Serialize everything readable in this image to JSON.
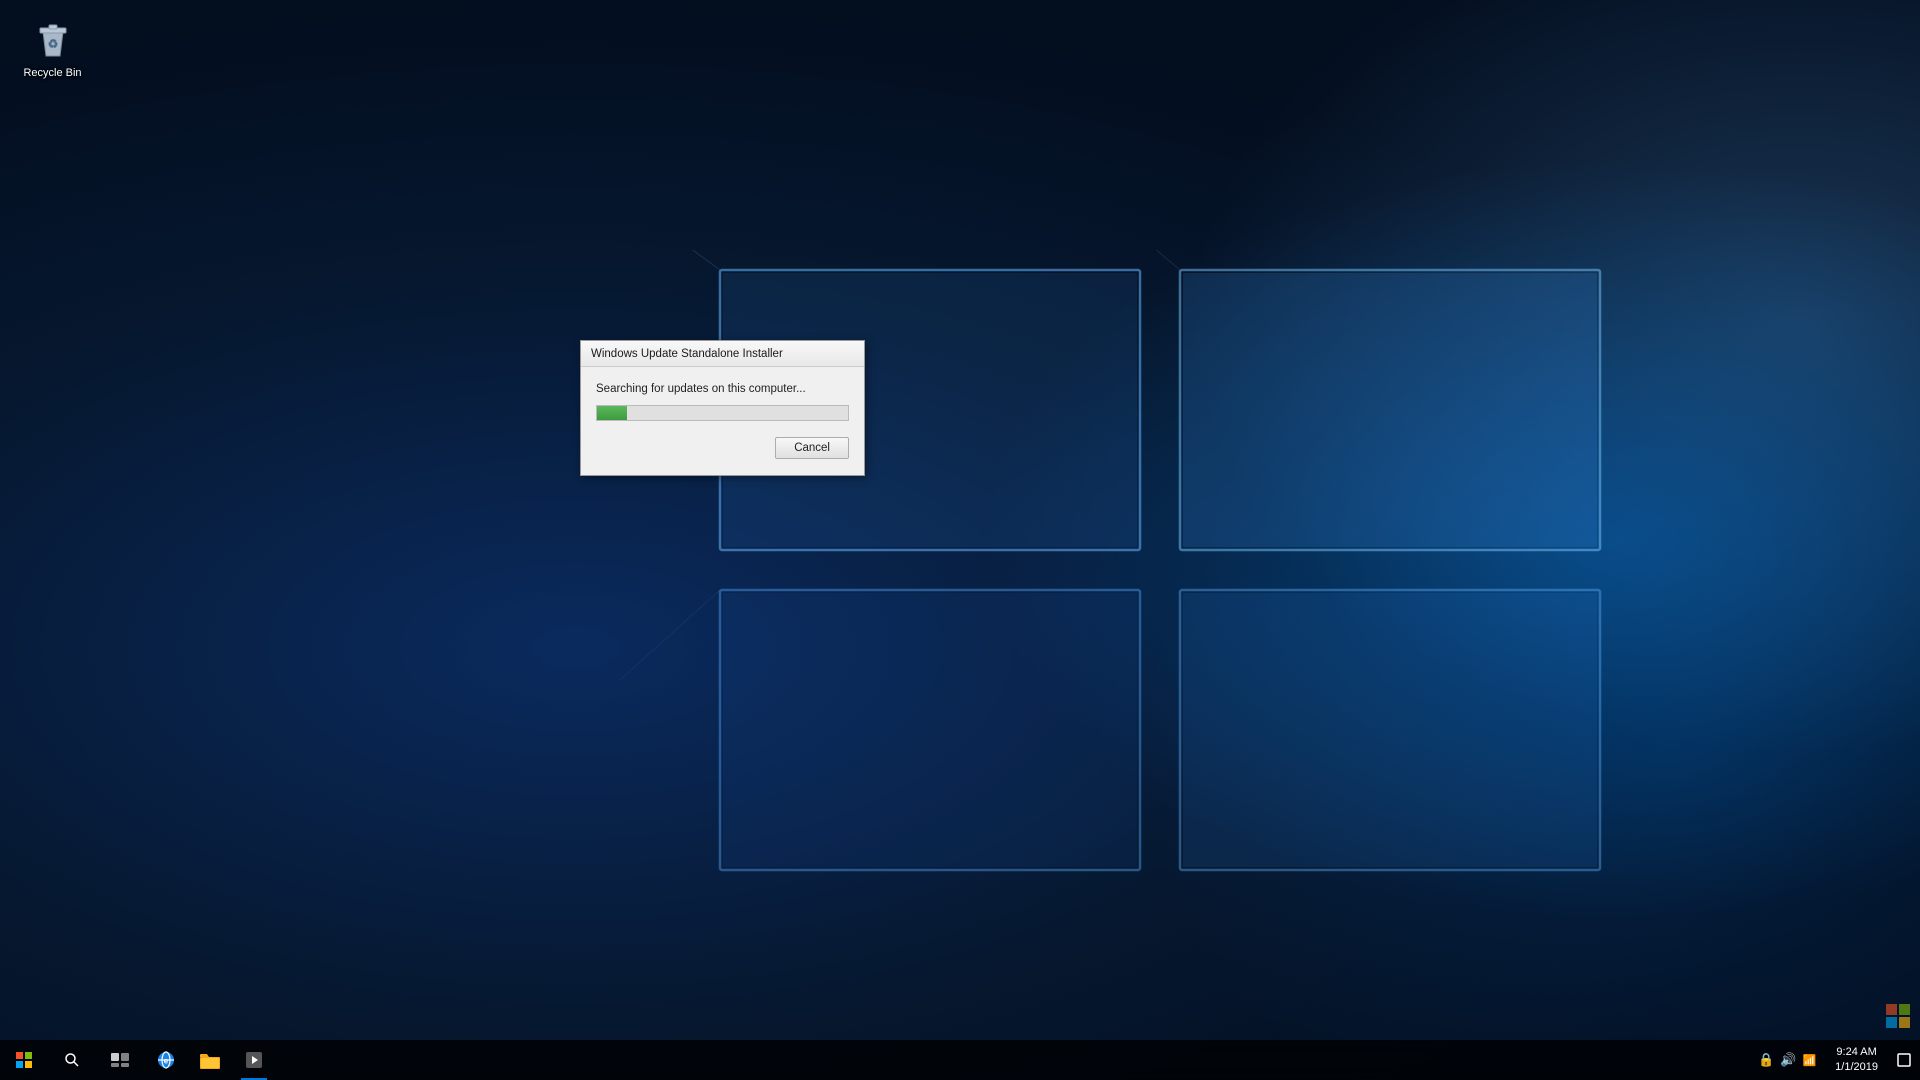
{
  "desktop": {
    "recycle_bin": {
      "label": "Recycle Bin"
    }
  },
  "dialog": {
    "title": "Windows Update Standalone Installer",
    "status_text": "Searching for updates on this computer...",
    "progress_percent": 12,
    "cancel_button_label": "Cancel"
  },
  "taskbar": {
    "start_label": "Start",
    "search_label": "Search",
    "task_view_label": "Task View",
    "apps": [
      {
        "name": "Internet Explorer",
        "icon": "ie"
      },
      {
        "name": "File Explorer",
        "icon": "folder"
      },
      {
        "name": "Windows Media Player",
        "icon": "media"
      }
    ],
    "tray": {
      "time": "9:24 AM",
      "date": "1/1/2019"
    }
  }
}
